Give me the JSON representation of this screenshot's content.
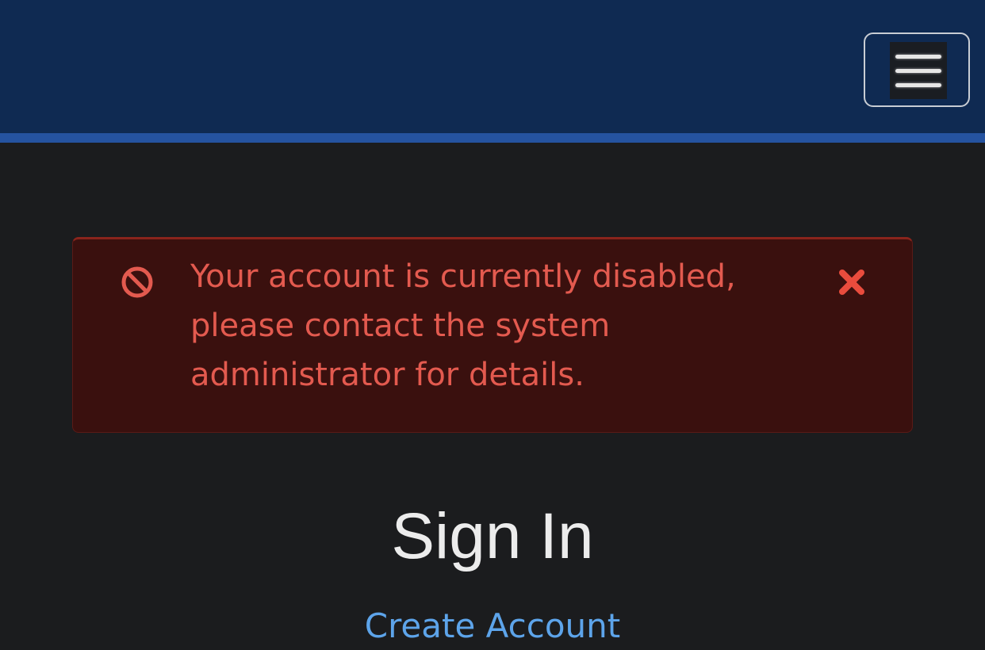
{
  "navbar": {
    "menu_icon": "hamburger-menu-icon"
  },
  "alert": {
    "icon": "no-entry-icon",
    "message": "Your account is currently disabled, please contact the system administrator for details.",
    "close_icon": "close-x-icon",
    "colors": {
      "background": "#3a100e",
      "text": "#e35a4f"
    }
  },
  "signin": {
    "title": "Sign In",
    "create_account_link": "Create Account"
  },
  "colors": {
    "navbar": "#0f2a52",
    "navbar_accent": "#2553a0",
    "page_background": "#1b1c1e",
    "link": "#5da4ea"
  }
}
